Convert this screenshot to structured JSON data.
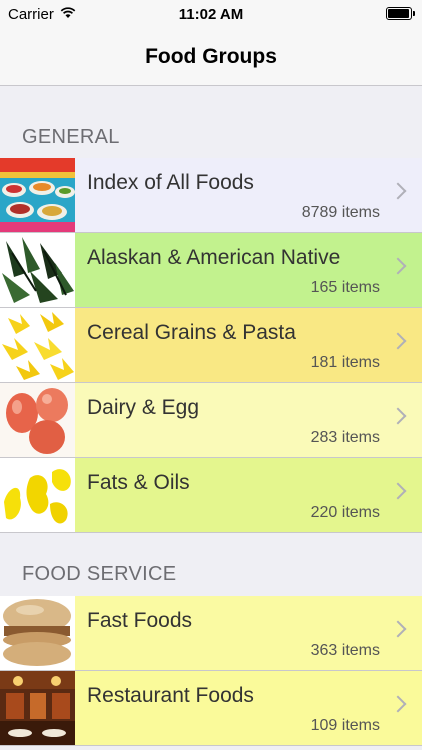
{
  "status": {
    "carrier": "Carrier",
    "time": "11:02 AM"
  },
  "nav": {
    "title": "Food Groups"
  },
  "sections": [
    {
      "header": "GENERAL",
      "items": [
        {
          "label": "Index of All Foods",
          "count": "8789 items",
          "bg": "#eeeefa"
        },
        {
          "label": "Alaskan & American Native",
          "count": "165 items",
          "bg": "#c2f28e"
        },
        {
          "label": "Cereal Grains & Pasta",
          "count": "181 items",
          "bg": "#f9e884"
        },
        {
          "label": "Dairy & Egg",
          "count": "283 items",
          "bg": "#fafab8"
        },
        {
          "label": "Fats & Oils",
          "count": "220 items",
          "bg": "#e4f68e"
        }
      ]
    },
    {
      "header": "FOOD SERVICE",
      "items": [
        {
          "label": "Fast Foods",
          "count": "363 items",
          "bg": "#fafaa2"
        },
        {
          "label": "Restaurant Foods",
          "count": "109 items",
          "bg": "#fafa9a"
        }
      ]
    }
  ]
}
